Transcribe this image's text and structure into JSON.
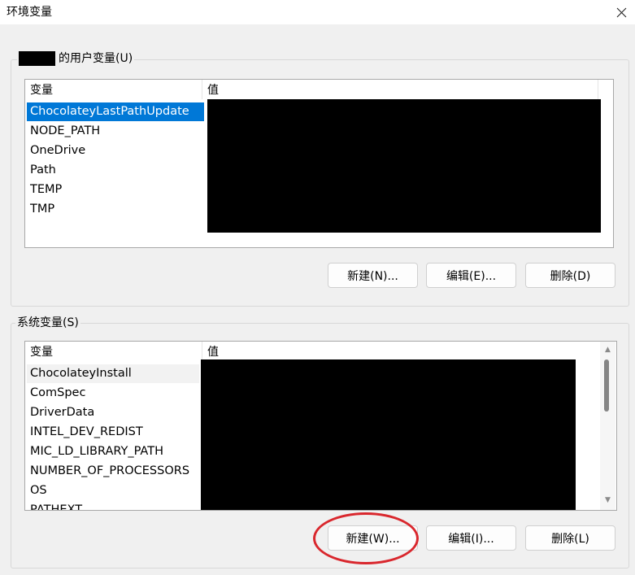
{
  "window": {
    "title": "环境变量",
    "close_icon": "close-icon"
  },
  "user_vars": {
    "group_label": "的用户变量(U)",
    "columns": [
      "变量",
      "值"
    ],
    "rows": [
      {
        "name": "ChocolateyLastPathUpdate",
        "selected": true
      },
      {
        "name": "NODE_PATH"
      },
      {
        "name": "OneDrive"
      },
      {
        "name": "Path"
      },
      {
        "name": "TEMP"
      },
      {
        "name": "TMP"
      }
    ],
    "buttons": {
      "new": "新建(N)...",
      "edit": "编辑(E)...",
      "delete": "删除(D)"
    }
  },
  "system_vars": {
    "group_label": "系统变量(S)",
    "columns": [
      "变量",
      "值"
    ],
    "rows": [
      {
        "name": "ChocolateyInstall",
        "hover": true
      },
      {
        "name": "ComSpec"
      },
      {
        "name": "DriverData"
      },
      {
        "name": "INTEL_DEV_REDIST"
      },
      {
        "name": "MIC_LD_LIBRARY_PATH"
      },
      {
        "name": "NUMBER_OF_PROCESSORS"
      },
      {
        "name": "OS"
      },
      {
        "name": "PATHEXT"
      }
    ],
    "buttons": {
      "new": "新建(W)...",
      "edit": "编辑(I)...",
      "delete": "删除(L)"
    }
  },
  "colors": {
    "selection": "#0078d7",
    "annotation": "#d9272d"
  }
}
